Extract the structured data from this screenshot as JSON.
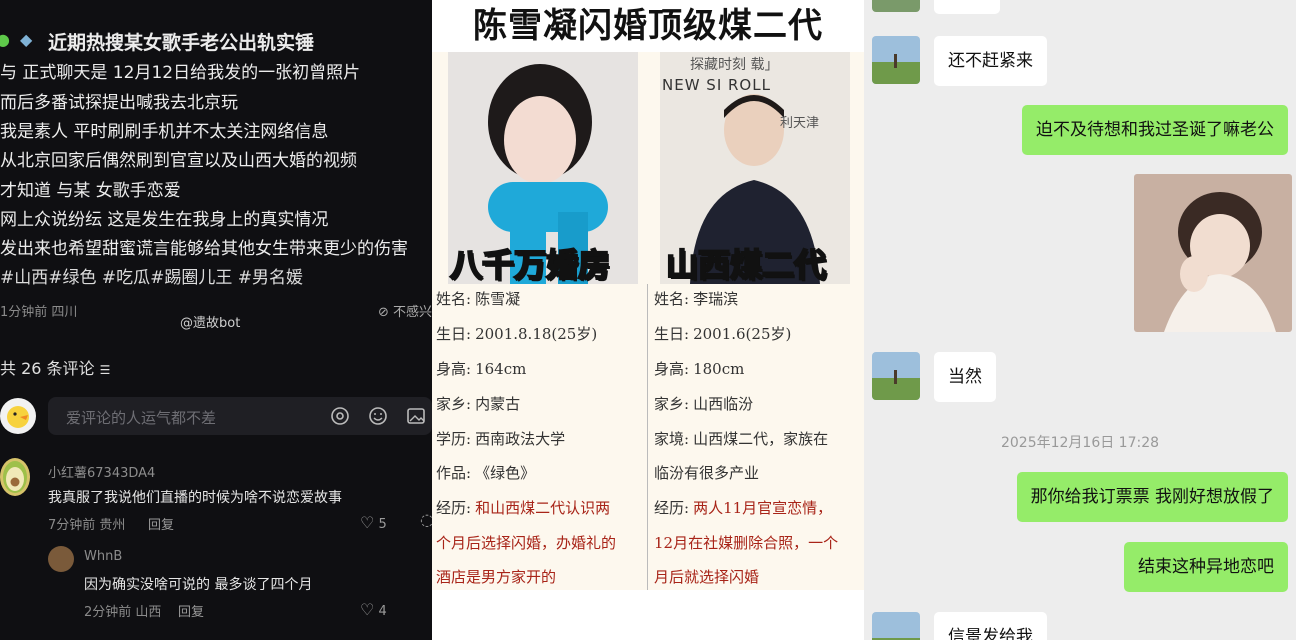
{
  "left": {
    "post_lines": [
      "近期热搜某女歌手老公出轨实锤",
      "与 正式聊天是 12月12日给我发的一张初曾照片",
      "而后多番试探提出喊我去北京玩",
      "我是素人 平时刷刷手机并不太关注网络信息",
      "从北京回家后偶然刷到官宣以及山西大婚的视频",
      "才知道 与某 女歌手恋爱",
      "网上众说纷纭 这是发生在我身上的真实情况",
      "发出来也希望甜蜜谎言能够给其他女生带来更少的伤害",
      "#山西#绿色 #吃瓜#踢圈儿王 #男名媛"
    ],
    "post_meta": "1分钟前 四川",
    "watermark": "@遗故bot",
    "no_disturb": "不感兴",
    "comment_count": "共 26 条评论",
    "comment_input_placeholder": "爱评论的人运气都不差",
    "comments": [
      {
        "name": "小红薯67343DA4",
        "text": "我真服了我说他们直播的时候为啥不说恋爱故事",
        "meta": "7分钟前 贵州",
        "reply": "回复",
        "likes": "5"
      },
      {
        "name": "WhnB",
        "text": "因为确实没啥可说的 最多谈了四个月",
        "meta": "2分钟前 山西",
        "reply": "回复",
        "likes": "4"
      }
    ]
  },
  "middle": {
    "title": "陈雪凝闪婚顶级煤二代",
    "female_caption": "八千万婚房",
    "male_caption": "山西煤二代",
    "male_bg_text_1": "探藏时刻 载」",
    "male_bg_text_2": "NEW SI   ROLL",
    "male_bg_text_3": "利天津",
    "female_rows": [
      {
        "k": "姓名:",
        "v": "陈雪凝"
      },
      {
        "k": "生日:",
        "v": "2001.8.18(25岁)"
      },
      {
        "k": "身高:",
        "v": "164cm"
      },
      {
        "k": "家乡:",
        "v": "内蒙古"
      },
      {
        "k": "学历:",
        "v": "西南政法大学"
      },
      {
        "k": "作品:",
        "v": "《绿色》"
      },
      {
        "k": "经历:",
        "v": "和山西煤二代认识两"
      }
    ],
    "female_exp_cont": [
      "个月后选择闪婚，办婚礼的",
      "酒店是男方家开的"
    ],
    "male_rows": [
      {
        "k": "姓名:",
        "v": "李瑞滨"
      },
      {
        "k": "生日:",
        "v": "2001.6(25岁)"
      },
      {
        "k": "身高:",
        "v": "180cm"
      },
      {
        "k": "家乡:",
        "v": "山西临汾"
      },
      {
        "k": "家境:",
        "v": "山西煤二代，家族在"
      },
      {
        "k": "",
        "v": "临汾有很多产业"
      },
      {
        "k": "经历:",
        "v": "两人11月官宣恋情，"
      }
    ],
    "male_exp_cont": [
      "12月在社媒删除合照，一个",
      "月后就选择闪婚"
    ]
  },
  "right": {
    "messages": [
      {
        "side": "in",
        "text": "还不赶紧来"
      },
      {
        "side": "out",
        "text": "迫不及待想和我过圣诞了嘛老公"
      },
      {
        "side": "in",
        "text": "当然"
      },
      {
        "side": "out",
        "text": "那你给我订票票 我刚好想放假了"
      },
      {
        "side": "out",
        "text": "结束这种异地恋吧"
      },
      {
        "side": "in",
        "text": "信景发给我"
      }
    ],
    "timestamp": "2025年12月16日 17:28"
  },
  "colors": {
    "wechat_green": "#95ec69",
    "dark_bg": "#0f0f12",
    "poster_red": "#a82418"
  }
}
